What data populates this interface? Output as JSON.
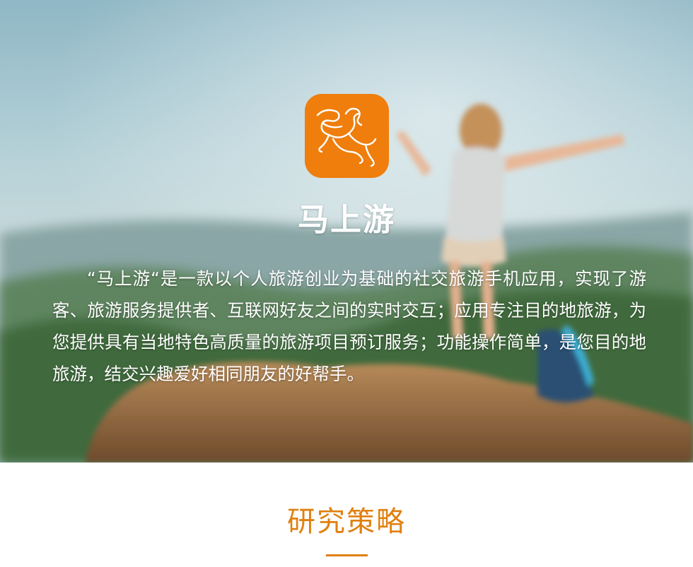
{
  "hero": {
    "app_icon": "horse-rider-logo-icon",
    "brand_color": "#ef7e0d",
    "app_name": "马上游",
    "intro": "“马上游“是一款以个人旅游创业为基础的社交旅游手机应用，实现了游客、旅游服务提供者、互联网好友之间的实时交互；应用专注目的地旅游，为您提供具有当地特色高质量的旅游项目预订服务；功能操作简单，是您目的地旅游，结交兴趣爱好相同朋友的好帮手。",
    "background_image": "woman-on-mountain-summit-photo"
  },
  "section": {
    "title": "研究策略",
    "accent_color": "#e0800f"
  }
}
